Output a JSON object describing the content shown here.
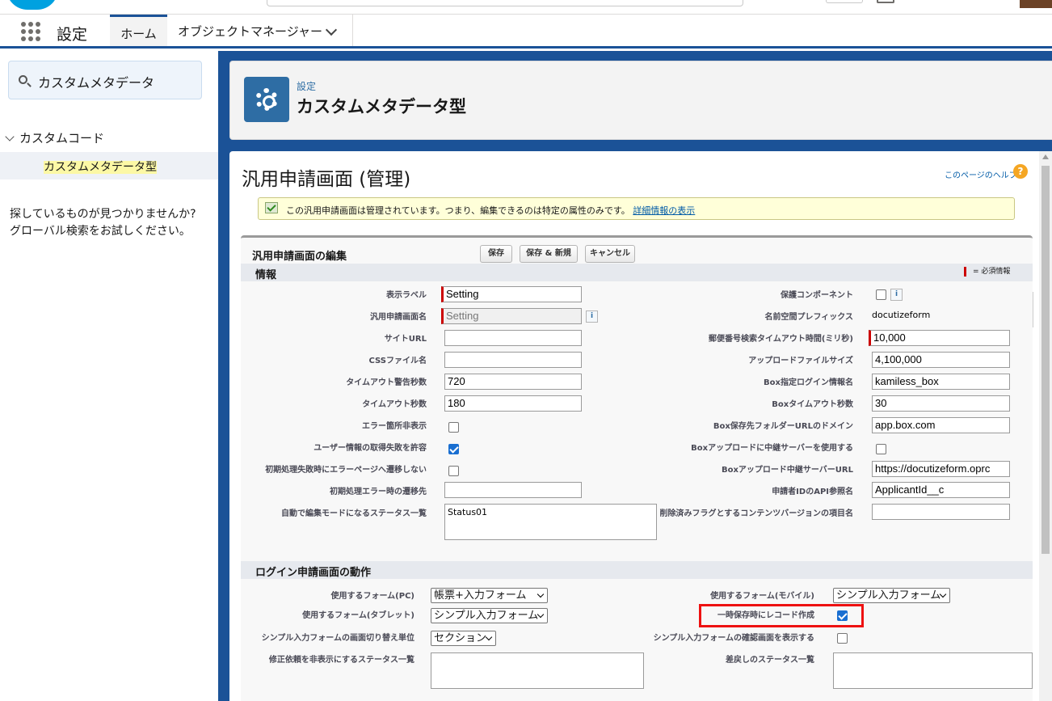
{
  "app": {
    "name": "設定"
  },
  "tabs": {
    "home": "ホーム",
    "object_manager": "オブジェクトマネージャー"
  },
  "sidebar": {
    "quickfind_value": "カスタムメタデータ",
    "tree_parent": "カスタムコード",
    "tree_child": "カスタムメタデータ型",
    "not_found_line1": "探しているものが見つかりませんか?",
    "not_found_line2": "グローバル検索をお試しください。"
  },
  "header": {
    "breadcrumb": "設定",
    "title": "カスタムメタデータ型"
  },
  "record": {
    "title": "汎用申請画面 (管理)",
    "help_link": "このページのヘルプ",
    "info_message": "この汎用申請画面は管理されています。つまり、編集できるのは特定の属性のみです。",
    "info_link": "詳細情報の表示"
  },
  "edit": {
    "title": "汎用申請画面の編集",
    "save": "保存",
    "save_new": "保存 & 新規",
    "cancel": "キャンセル",
    "section_info": "情報",
    "required_legend": "= 必須情報",
    "section_login": "ログイン申請画面の動作"
  },
  "left_fields": {
    "display_label": {
      "label": "表示ラベル",
      "value": "Setting"
    },
    "name": {
      "label": "汎用申請画面名",
      "value": "Setting"
    },
    "site_url": {
      "label": "サイトURL",
      "value": ""
    },
    "css_file": {
      "label": "CSSファイル名",
      "value": ""
    },
    "timeout_warn": {
      "label": "タイムアウト警告秒数",
      "value": "720"
    },
    "timeout": {
      "label": "タイムアウト秒数",
      "value": "180"
    },
    "hide_error": {
      "label": "エラー箇所非表示"
    },
    "allow_user_fail": {
      "label": "ユーザー情報の取得失敗を許容"
    },
    "no_error_page": {
      "label": "初期処理失敗時にエラーページへ遷移しない"
    },
    "init_error_dest": {
      "label": "初期処理エラー時の遷移先",
      "value": ""
    },
    "auto_edit_status": {
      "label": "自動で編集モードになるステータス一覧",
      "value": "Status01"
    }
  },
  "right_fields": {
    "protected": {
      "label": "保護コンポーネント"
    },
    "namespace": {
      "label": "名前空間プレフィックス",
      "value": "docutizeform"
    },
    "zip_timeout": {
      "label": "郵便番号検索タイムアウト時間(ミリ秒)",
      "value": "10,000"
    },
    "upload_size": {
      "label": "アップロードファイルサイズ",
      "value": "4,100,000"
    },
    "box_login": {
      "label": "Box指定ログイン情報名",
      "value": "kamiless_box"
    },
    "box_timeout": {
      "label": "Boxタイムアウト秒数",
      "value": "30"
    },
    "box_domain": {
      "label": "Box保存先フォルダーURLのドメイン",
      "value": "app.box.com"
    },
    "box_relay": {
      "label": "Boxアップロードに中継サーバーを使用する"
    },
    "box_relay_url": {
      "label": "Boxアップロード中継サーバーURL",
      "value": "https://docutizeform.oprc"
    },
    "applicant_id": {
      "label": "申請者IDのAPI参照名",
      "value": "ApplicantId__c"
    },
    "deleted_flag": {
      "label": "削除済みフラグとするコンテンツバージョンの項目名",
      "value": ""
    }
  },
  "login_fields": {
    "form_pc": {
      "label": "使用するフォーム(PC)",
      "value": "帳票+入力フォーム"
    },
    "form_mobile": {
      "label": "使用するフォーム(モバイル)",
      "value": "シンプル入力フォーム"
    },
    "form_tablet": {
      "label": "使用するフォーム(タブレット)",
      "value": "シンプル入力フォーム"
    },
    "temp_save": {
      "label": "一時保存時にレコード作成"
    },
    "switch_unit": {
      "label": "シンプル入力フォームの画面切り替え単位",
      "value": "セクション"
    },
    "show_confirm": {
      "label": "シンプル入力フォームの確認画面を表示する"
    },
    "hide_fix_status": {
      "label": "修正依頼を非表示にするステータス一覧",
      "value": ""
    },
    "return_status": {
      "label": "差戻しのステータス一覧",
      "value": ""
    }
  },
  "checkbox_states": {
    "hide_error": false,
    "allow_user_fail": true,
    "no_error_page": false,
    "protected": false,
    "box_relay": false,
    "temp_save": true,
    "show_confirm": false
  },
  "colors": {
    "nav_accent": "#1b5297",
    "highlight_border": "#e11111",
    "required": "#cc0000"
  }
}
